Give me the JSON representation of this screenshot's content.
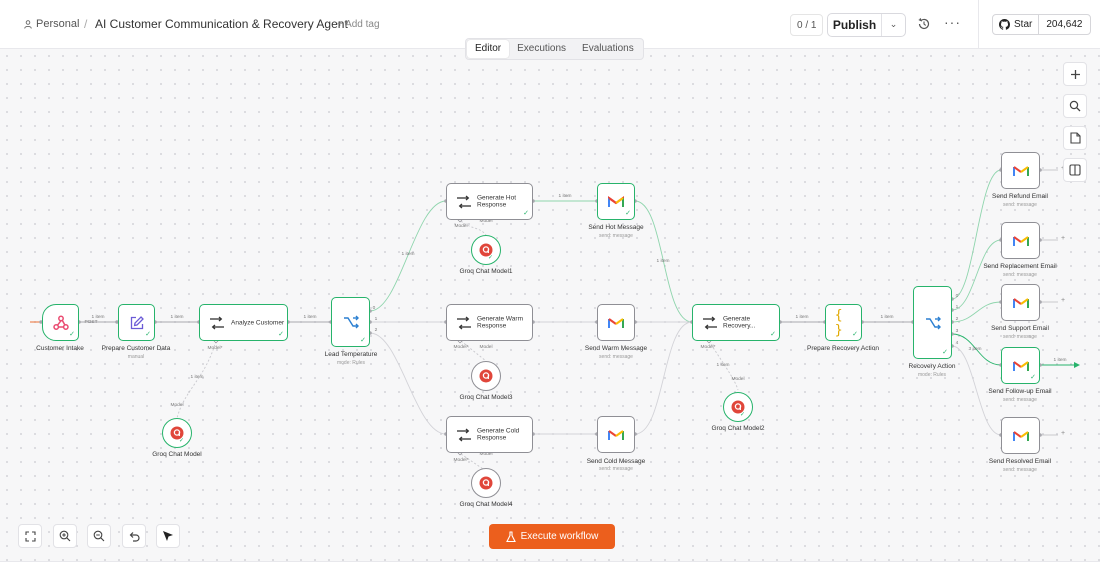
{
  "header": {
    "workspace": "Personal",
    "workflow_name": "AI Customer Communication & Recovery Agent",
    "add_tag": "+ Add tag",
    "counter": "0 / 1",
    "publish_label": "Publish",
    "star_label": "Star",
    "star_count": "204,642"
  },
  "tabs": [
    "Editor",
    "Executions",
    "Evaluations"
  ],
  "active_tab": "Editor",
  "nodes": {
    "customer_intake": {
      "label": "Customer Intake"
    },
    "prepare_customer_data": {
      "label": "Prepare Customer Data",
      "sub": "manual"
    },
    "analyze_customer": {
      "label": "Analyze Customer"
    },
    "groq_chat_model": {
      "label": "Groq Chat Model"
    },
    "lead_temperature": {
      "label": "Lead Temperature",
      "sub": "mode: Rules"
    },
    "generate_hot_response": {
      "label": "Generate Hot Response"
    },
    "generate_warm_response": {
      "label": "Generate Warm Response"
    },
    "generate_cold_response": {
      "label": "Generate Cold Response"
    },
    "groq_chat_model1": {
      "label": "Groq Chat Model1"
    },
    "groq_chat_model3": {
      "label": "Groq Chat Model3"
    },
    "groq_chat_model4": {
      "label": "Groq Chat Model4"
    },
    "send_hot_message": {
      "label": "Send Hot Message",
      "sub": "send: message"
    },
    "send_warm_message": {
      "label": "Send Warm Message",
      "sub": "send: message"
    },
    "send_cold_message": {
      "label": "Send Cold Message",
      "sub": "send: message"
    },
    "generate_recovery": {
      "label": "Generate Recovery..."
    },
    "groq_chat_model2": {
      "label": "Groq Chat Model2"
    },
    "prepare_recovery_action": {
      "label": "Prepare Recovery Action"
    },
    "recovery_action": {
      "label": "Recovery Action",
      "sub": "mode: Rules"
    },
    "send_refund_email": {
      "label": "Send Refund Email",
      "sub": "send: message"
    },
    "send_replacement_email": {
      "label": "Send Replacement Email",
      "sub": "send: message"
    },
    "send_support_email": {
      "label": "Send Support Email",
      "sub": "send: message"
    },
    "send_followup_email": {
      "label": "Send Follow-up Email",
      "sub": "send: message"
    },
    "send_resolved_email": {
      "label": "Send Resolved Email",
      "sub": "send: message"
    }
  },
  "edge_labels": {
    "item": "1 item",
    "item_3": "3 item",
    "post": "POST",
    "model": "Model",
    "model_req": "Model*",
    "out_0": "0",
    "out_1": "1",
    "out_2": "2",
    "out_3": "3",
    "out_4": "4"
  },
  "execute_label": "Execute workflow",
  "colors": {
    "accent": "#ec5f1d",
    "success": "#27b36b",
    "webhook": "#ea4b71",
    "gmail_red": "#ea4335"
  }
}
